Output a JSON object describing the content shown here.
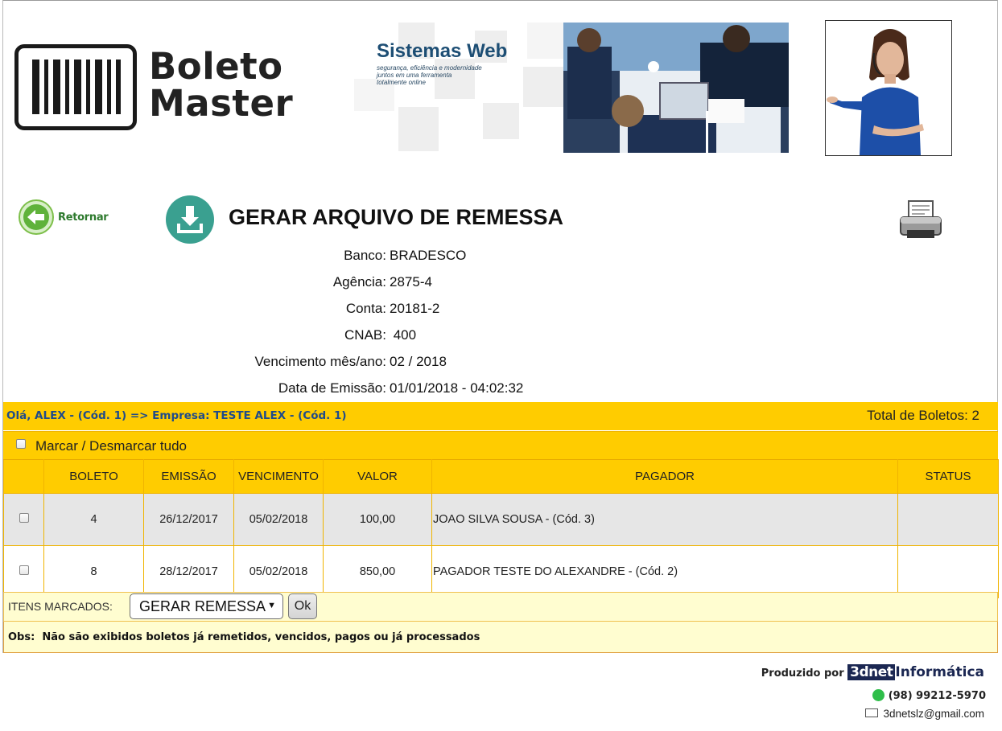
{
  "logo": {
    "line1": "Boleto",
    "line2": "Master"
  },
  "banner": {
    "title": "Sistemas Web",
    "subtitle_1": "segurança, eficiência e modernidade",
    "subtitle_2": "juntos em uma ferramenta",
    "subtitle_3": "totalmente online"
  },
  "actions": {
    "return_label": "Retornar"
  },
  "page_title": "GERAR ARQUIVO DE REMESSA",
  "info": [
    {
      "label": "Banco:",
      "value": "BRADESCO"
    },
    {
      "label": "Agência:",
      "value": "2875-4"
    },
    {
      "label": "Conta:",
      "value": "20181-2"
    },
    {
      "label": "CNAB:",
      "value": " 400"
    },
    {
      "label": "Vencimento mês/ano:",
      "value": "02 / 2018"
    },
    {
      "label": "Data de Emissão:",
      "value": "01/01/2018 - 04:02:32"
    }
  ],
  "greeting": "Olá, ALEX - (Cód. 1) => Empresa: TESTE ALEX - (Cód. 1)",
  "total": "Total de Boletos: 2",
  "mark_all_label": "Marcar / Desmarcar tudo",
  "table": {
    "headers": [
      "",
      "BOLETO",
      "EMISSÃO",
      "VENCIMENTO",
      "VALOR",
      "PAGADOR",
      "STATUS"
    ],
    "rows": [
      {
        "boleto": "4",
        "emissao": "26/12/2017",
        "vencimento": "05/02/2018",
        "valor": "100,00",
        "pagador": "JOAO SILVA SOUSA - (Cód. 3)",
        "status": ""
      },
      {
        "boleto": "8",
        "emissao": "28/12/2017",
        "vencimento": "05/02/2018",
        "valor": "850,00",
        "pagador": "PAGADOR TESTE DO ALEXANDRE - (Cód. 2)",
        "status": ""
      }
    ]
  },
  "items": {
    "label": "ITENS MARCADOS:",
    "selected": "GERAR REMESSA",
    "ok_label": "Ok"
  },
  "obs": "Obs:  Não são exibidos boletos já remetidos, vencidos, pagos ou já processados",
  "footer": {
    "produced_by": "Produzido por",
    "brand_a": "3dnet",
    "brand_b": "Informática",
    "phone": "(98) 99212-5970",
    "email": "3dnetslz@gmail.com"
  },
  "colors": {
    "accent_yellow": "#ffcc00",
    "light_yellow": "#fffdd0",
    "title_blue": "#1d4e74",
    "green": "#2e7a2e"
  }
}
